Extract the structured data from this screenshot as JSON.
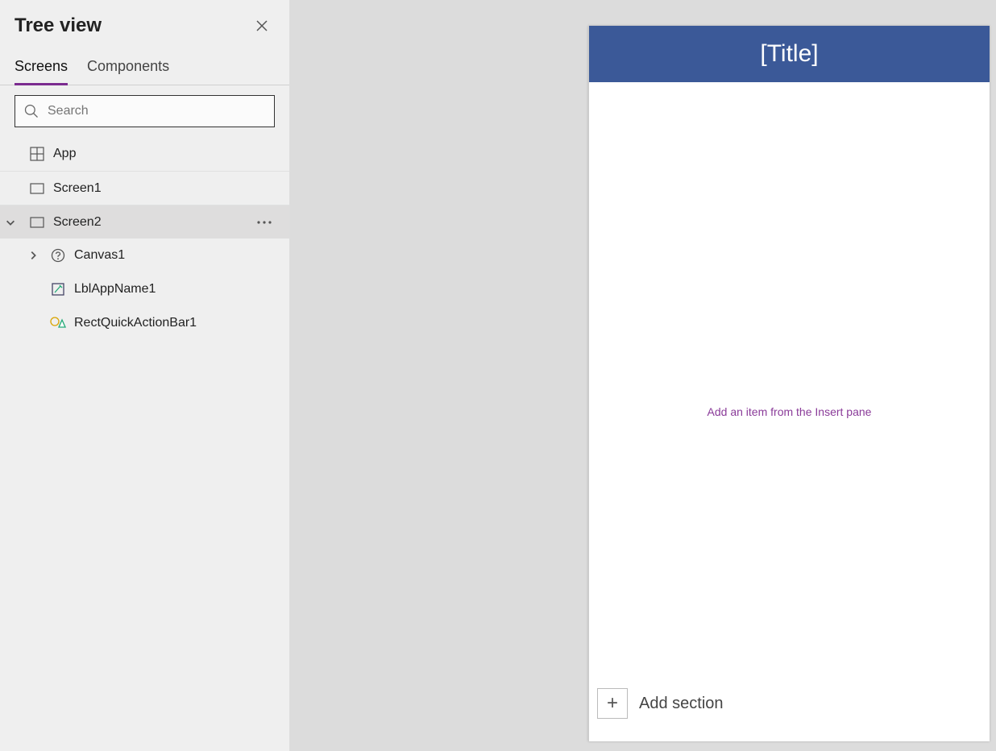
{
  "sidebar": {
    "title": "Tree view",
    "tabs": {
      "screens": "Screens",
      "components": "Components"
    },
    "search_placeholder": "Search",
    "items": {
      "app": "App",
      "screen1": "Screen1",
      "screen2": "Screen2",
      "canvas1": "Canvas1",
      "lblappname1": "LblAppName1",
      "rectquickactionbar1": "RectQuickActionBar1"
    }
  },
  "preview": {
    "title": "[Title]",
    "empty_hint": "Add an item from the Insert pane",
    "add_section": "Add section"
  }
}
